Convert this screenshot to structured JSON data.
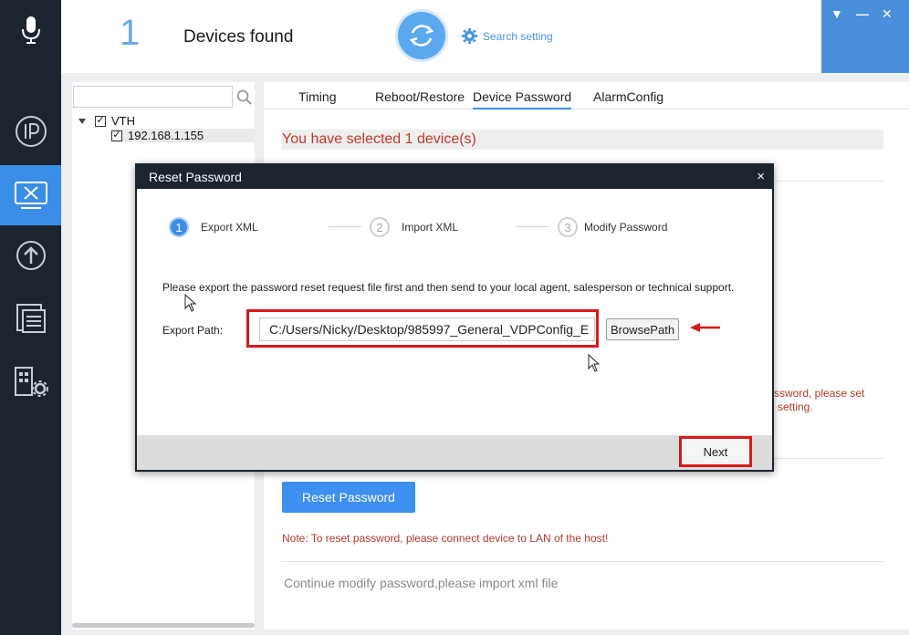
{
  "header": {
    "device_count": "1",
    "devices_found_label": "Devices found",
    "search_setting_label": "Search setting"
  },
  "sidebar": {
    "items": [
      {
        "icon": "microphone-icon"
      },
      {
        "icon": "ip-icon"
      },
      {
        "icon": "tools-monitor-icon",
        "active": true
      },
      {
        "icon": "upgrade-icon"
      },
      {
        "icon": "document-list-icon"
      },
      {
        "icon": "building-config-icon"
      }
    ]
  },
  "tree": {
    "root_label": "VTH",
    "child_label": "192.168.1.155"
  },
  "tabs": [
    {
      "label": "Timing"
    },
    {
      "label": "Reboot/Restore"
    },
    {
      "label": "Device Password",
      "active": true
    },
    {
      "label": "AlarmConfig"
    }
  ],
  "main": {
    "selected_text": "You have selected 1 device(s)",
    "partial_message_line1": "ssword, please set",
    "partial_message_line2": "setting.",
    "reset_button": "Reset Password",
    "note": "Note: To reset password, please connect device to LAN of the host!",
    "continue_text": "Continue modify password,please import xml file"
  },
  "modal": {
    "title": "Reset Password",
    "close": "×",
    "steps": [
      {
        "num": "1",
        "label": "Export XML"
      },
      {
        "num": "2",
        "label": "Import XML"
      },
      {
        "num": "3",
        "label": "Modify Password"
      }
    ],
    "instruction": "Please export the password reset request file first and then send to your local agent, salesperson or technical support.",
    "export_path_label": "Export Path:",
    "export_path_value": "C:/Users/Nicky/Desktop/985997_General_VDPConfig_E",
    "browse_button": "BrowsePath",
    "next_button": "Next"
  },
  "colors": {
    "accent": "#3b8ee8",
    "sidebar": "#1c2430",
    "highlight": "#d81a1a",
    "warning_text": "#b0392b"
  }
}
